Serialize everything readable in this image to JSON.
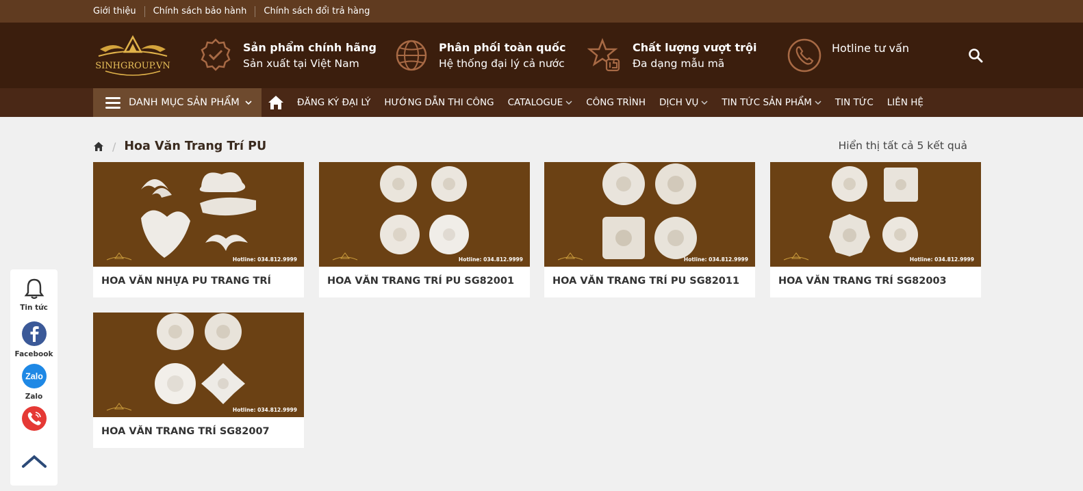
{
  "topbar": {
    "links": [
      "Giới thiệu",
      "Chính sách bảo hành",
      "Chính sách đổi trả hàng"
    ]
  },
  "header": {
    "logo_text": "SINHGROUP.VN",
    "features": [
      {
        "title": "Sản phẩm chính hãng",
        "subtitle": "Sản xuất tại Việt Nam",
        "icon": "badge-check-icon"
      },
      {
        "title": "Phân phối toàn quốc",
        "subtitle": "Hệ thống đại lý cả nước",
        "icon": "globe-icon"
      },
      {
        "title": "Chất lượng vượt trội",
        "subtitle": "Đa dạng mẫu mã",
        "icon": "star-thumb-icon"
      },
      {
        "title": "Hotline tư vấn",
        "subtitle": "",
        "icon": "phone-icon"
      }
    ]
  },
  "nav": {
    "menu_label": "DANH MỤC SẢN PHẨM",
    "items": [
      "ĐĂNG KÝ ĐẠI LÝ",
      "HƯỚNG DẪN THI CÔNG",
      "CATALOGUE",
      "CÔNG TRÌNH",
      "DỊCH VỤ",
      "TIN TỨC SẢN PHẨM",
      "TIN TỨC",
      "LIÊN HỆ"
    ]
  },
  "breadcrumb": {
    "current": "Hoa Văn Trang Trí PU"
  },
  "result_count": "Hiển thị tất cả 5 kết quả",
  "products": [
    {
      "name": "HOA VĂN NHỰA PU TRANG TRÍ",
      "hotline": "Hotline: 034.812.9999"
    },
    {
      "name": "HOA VĂN TRANG TRÍ PU SG82001",
      "hotline": "Hotline: 034.812.9999"
    },
    {
      "name": "HOA VĂN TRANG TRÍ PU SG82011",
      "hotline": "Hotline: 034.812.9999"
    },
    {
      "name": "HOA VĂN TRANG TRÍ SG82003",
      "hotline": "Hotline: 034.812.9999"
    },
    {
      "name": "HOA VĂN TRANG TRÍ SG82007",
      "hotline": "Hotline: 034.812.9999"
    }
  ],
  "side": {
    "news": "Tin tức",
    "facebook": "Facebook",
    "zalo": "Zalo",
    "zalo_logo": "Zalo"
  },
  "colors": {
    "topbar": "#603b20",
    "header": "#3b1e0d",
    "nav": "#4a2816",
    "accent": "#a86a45",
    "card_bg": "#6b4114"
  }
}
